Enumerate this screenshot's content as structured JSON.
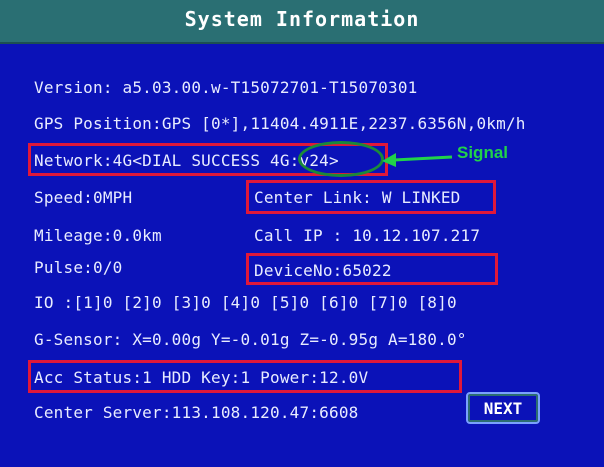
{
  "title": "System Information",
  "lines": {
    "version": "Version:  a5.03.00.w-T15072701-T15070301",
    "gps": "GPS Position:GPS [0*],11404.4911E,2237.6356N,0km/h",
    "network": "Network:4G<DIAL SUCCESS 4G:v24>",
    "speed": "Speed:0MPH",
    "center_link": "Center Link: W LINKED",
    "mileage": "Mileage:0.0km",
    "call_ip": "Call IP :  10.12.107.217",
    "pulse": "Pulse:0/0",
    "device_no": "DeviceNo:65022",
    "io": "IO  :[1]0 [2]0 [3]0 [4]0 [5]0 [6]0 [7]0 [8]0",
    "gsensor": "G-Sensor: X=0.00g Y=-0.01g Z=-0.95g A=180.0°",
    "acc_status": "Acc Status:1   HDD Key:1   Power:12.0V",
    "center_server": "Center Server:113.108.120.47:6608"
  },
  "annotation": {
    "signal_label": "Signal"
  },
  "buttons": {
    "next": "NEXT"
  },
  "colors": {
    "background": "#0b12b8",
    "titlebar": "#2a6f73",
    "highlight_box": "#e0183a",
    "signal_annotation": "#21d24a"
  }
}
